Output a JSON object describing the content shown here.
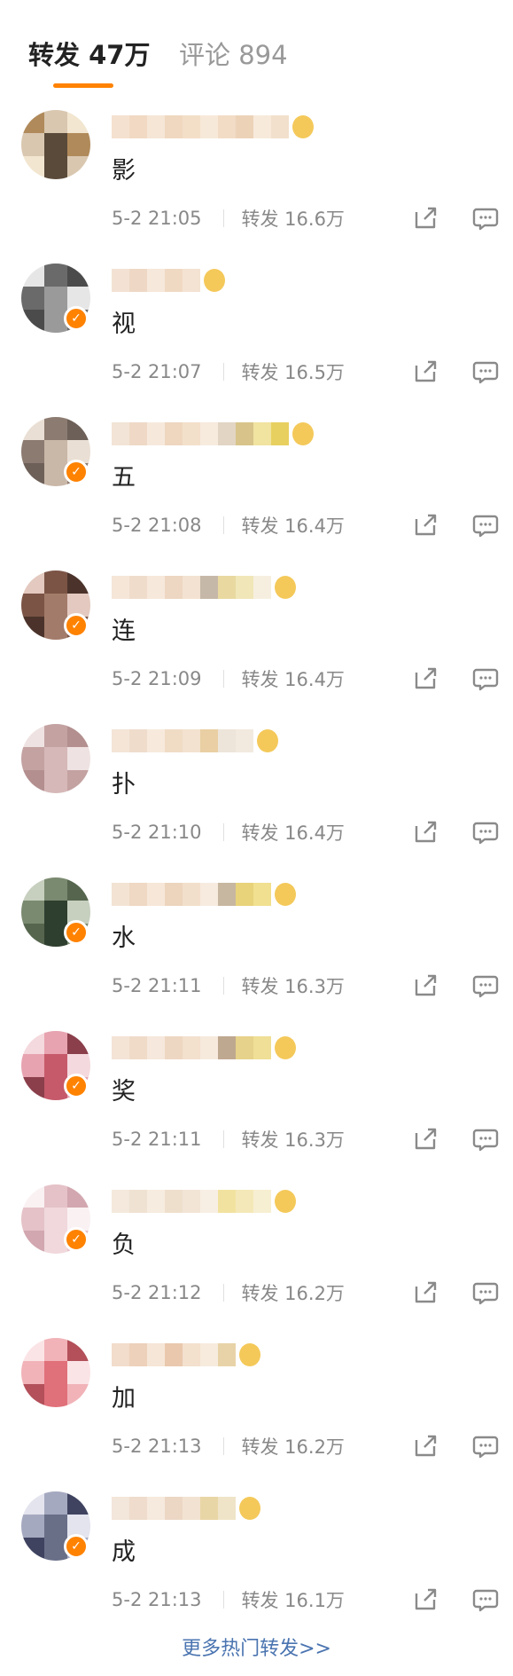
{
  "tabs": {
    "repost_label": "转发 47万",
    "comment_label": "评论 894"
  },
  "colors": {
    "accent": "#ff8200",
    "link": "#4a74b0",
    "muted": "#888888"
  },
  "items": [
    {
      "avatar_colors": [
        "#5a4a3a",
        "#d9c7b0",
        "#b08a5a",
        "#f2e6d0"
      ],
      "verified": false,
      "content": "影",
      "time": "5-2 21:05",
      "repost": "转发 16.6万"
    },
    {
      "avatar_colors": [
        "#9a9a9a",
        "#6a6a6a",
        "#e6e6e6",
        "#4b4b4b"
      ],
      "verified": true,
      "content": "视",
      "time": "5-2 21:07",
      "repost": "转发 16.5万"
    },
    {
      "avatar_colors": [
        "#c9b7a8",
        "#8c7b70",
        "#eadfd4",
        "#6d6058"
      ],
      "verified": true,
      "content": "五",
      "time": "5-2 21:08",
      "repost": "转发 16.4万"
    },
    {
      "avatar_colors": [
        "#a37b6a",
        "#7b5446",
        "#e3c9bf",
        "#4b332b"
      ],
      "verified": true,
      "content": "连",
      "time": "5-2 21:09",
      "repost": "转发 16.4万"
    },
    {
      "avatar_colors": [
        "#d6b8b8",
        "#c4a2a2",
        "#efe2e2",
        "#b38f8f"
      ],
      "verified": false,
      "content": "扑",
      "time": "5-2 21:10",
      "repost": "转发 16.4万"
    },
    {
      "avatar_colors": [
        "#2f3f2f",
        "#7a8a70",
        "#c7d0bf",
        "#56664e"
      ],
      "verified": true,
      "content": "水",
      "time": "5-2 21:11",
      "repost": "转发 16.3万"
    },
    {
      "avatar_colors": [
        "#c65a6a",
        "#e7a3b0",
        "#f4d9de",
        "#8a3f4b"
      ],
      "verified": true,
      "content": "奖",
      "time": "5-2 21:11",
      "repost": "转发 16.3万"
    },
    {
      "avatar_colors": [
        "#f0d8dc",
        "#e5c2c8",
        "#faf1f3",
        "#d2a7af"
      ],
      "verified": true,
      "content": "负",
      "time": "5-2 21:12",
      "repost": "转发 16.2万"
    },
    {
      "avatar_colors": [
        "#e0707a",
        "#f1b3b8",
        "#fbe4e6",
        "#b3505a"
      ],
      "verified": false,
      "content": "加",
      "time": "5-2 21:13",
      "repost": "转发 16.2万"
    },
    {
      "avatar_colors": [
        "#6a6f88",
        "#a5a9c0",
        "#e3e4ee",
        "#3f4360"
      ],
      "verified": true,
      "content": "成",
      "time": "5-2 21:13",
      "repost": "转发 16.1万"
    }
  ],
  "more_link": "更多热门转发>>"
}
